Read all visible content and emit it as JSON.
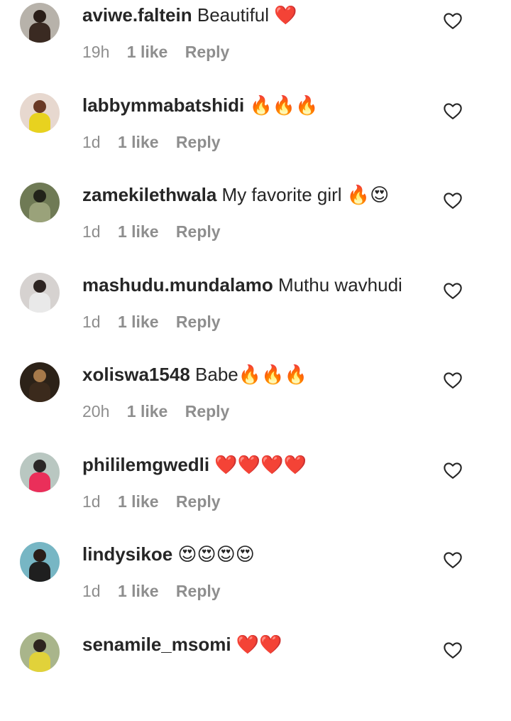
{
  "comments": [
    {
      "username": "aviwe.faltein",
      "text": "Beautiful ❤️",
      "time": "19h",
      "likes": "1 like",
      "reply": "Reply",
      "avatar": {
        "bg": "#b7b2aa",
        "fg": "#2a1e18",
        "accent": "#3a2a22"
      }
    },
    {
      "username": "labbymmabatshidi",
      "text": "🔥🔥🔥",
      "time": "1d",
      "likes": "1 like",
      "reply": "Reply",
      "avatar": {
        "bg": "#e7d8cf",
        "fg": "#6a3a26",
        "accent": "#e8d21f"
      }
    },
    {
      "username": "zamekilethwala",
      "text": "My favorite girl 🔥😍",
      "time": "1d",
      "likes": "1 like",
      "reply": "Reply",
      "avatar": {
        "bg": "#6f7a55",
        "fg": "#22231a",
        "accent": "#9aa27a"
      }
    },
    {
      "username": "mashudu.mundalamo",
      "text": "Muthu wavhudi",
      "time": "1d",
      "likes": "1 like",
      "reply": "Reply",
      "avatar": {
        "bg": "#d6d2d0",
        "fg": "#2d2421",
        "accent": "#e9e9e9"
      }
    },
    {
      "username": "xoliswa1548",
      "text": "Babe🔥🔥🔥",
      "time": "20h",
      "likes": "1 like",
      "reply": "Reply",
      "avatar": {
        "bg": "#2c2218",
        "fg": "#a77a4a",
        "accent": "#3b2a1c"
      }
    },
    {
      "username": "phililemgwedli",
      "text": "❤️❤️❤️❤️",
      "time": "1d",
      "likes": "1 like",
      "reply": "Reply",
      "avatar": {
        "bg": "#b9c7c1",
        "fg": "#2b2727",
        "accent": "#ea2f5a"
      }
    },
    {
      "username": "lindysikoe",
      "text": "😍😍😍😍",
      "time": "1d",
      "likes": "1 like",
      "reply": "Reply",
      "avatar": {
        "bg": "#77b6c4",
        "fg": "#2a1d18",
        "accent": "#1f1f1f"
      }
    },
    {
      "username": "senamile_msomi",
      "text": "❤️❤️",
      "time": "",
      "likes": "",
      "reply": "",
      "avatar": {
        "bg": "#a9b58b",
        "fg": "#2e241f",
        "accent": "#e1d23a"
      }
    }
  ]
}
